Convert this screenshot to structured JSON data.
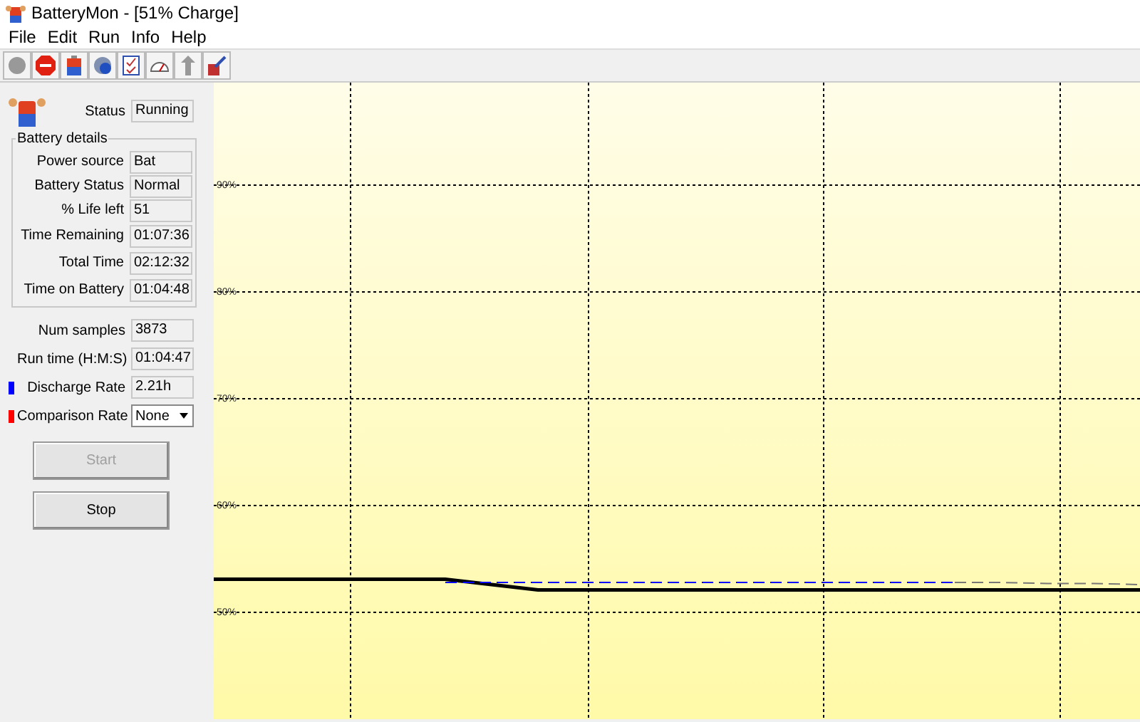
{
  "window": {
    "title": "BatteryMon - [51% Charge]"
  },
  "menu": [
    "File",
    "Edit",
    "Run",
    "Info",
    "Help"
  ],
  "status": {
    "label": "Status",
    "value": "Running"
  },
  "battery_details": {
    "title": "Battery details",
    "fields": [
      {
        "label": "Power source",
        "value": "Bat"
      },
      {
        "label": "Battery Status",
        "value": "Normal"
      },
      {
        "label": "% Life left",
        "value": "51"
      },
      {
        "label": "Time Remaining",
        "value": "01:07:36"
      },
      {
        "label": "Total Time",
        "value": "02:12:32"
      },
      {
        "label": "Time on Battery",
        "value": "01:04:48"
      }
    ]
  },
  "stats": [
    {
      "label": "Num samples",
      "value": "3873",
      "kind": "text"
    },
    {
      "label": "Run time (H:M:S)",
      "value": "01:04:47",
      "kind": "text"
    },
    {
      "label": "Discharge Rate",
      "value": "2.21h",
      "kind": "text",
      "color": "#0000ff"
    },
    {
      "label": "Comparison Rate",
      "value": "None",
      "kind": "dropdown",
      "color": "#ff0000"
    }
  ],
  "buttons": [
    {
      "label": "Start",
      "disabled": true
    },
    {
      "label": "Stop",
      "disabled": false
    }
  ],
  "chart": {
    "chart_data": {
      "type": "line",
      "grid": true,
      "ylim": [
        40,
        99.6
      ],
      "yticks": [
        {
          "value": 50,
          "label": "50%"
        },
        {
          "value": 60,
          "label": "60%"
        },
        {
          "value": 70,
          "label": "70%"
        },
        {
          "value": 80,
          "label": "80%"
        },
        {
          "value": 90,
          "label": "90%"
        }
      ],
      "series": [
        {
          "color": "#000000",
          "line_style": "solid",
          "values": [
            53.1,
            53.1,
            53.1,
            53.1,
            53.1,
            53.1,
            52.6,
            52.1,
            52.1,
            52.1,
            52.1,
            52.1,
            52.1,
            52.1,
            52.1,
            52.1,
            52.1,
            52.1,
            52.1,
            52.1,
            52.1
          ]
        },
        {
          "color": "#0000ff",
          "line_style": "dashed",
          "values": [
            null,
            null,
            null,
            null,
            null,
            52.8,
            52.8,
            52.8,
            52.8,
            52.8,
            52.8,
            52.8,
            52.8,
            52.8,
            52.8,
            52.8,
            52.8,
            null,
            null,
            null,
            null
          ]
        },
        {
          "color": "#777777",
          "line_style": "dashed",
          "values": [
            null,
            null,
            null,
            null,
            null,
            null,
            null,
            null,
            null,
            null,
            null,
            null,
            null,
            null,
            null,
            null,
            52.8,
            52.8,
            52.7,
            52.7,
            52.6
          ]
        }
      ]
    }
  }
}
